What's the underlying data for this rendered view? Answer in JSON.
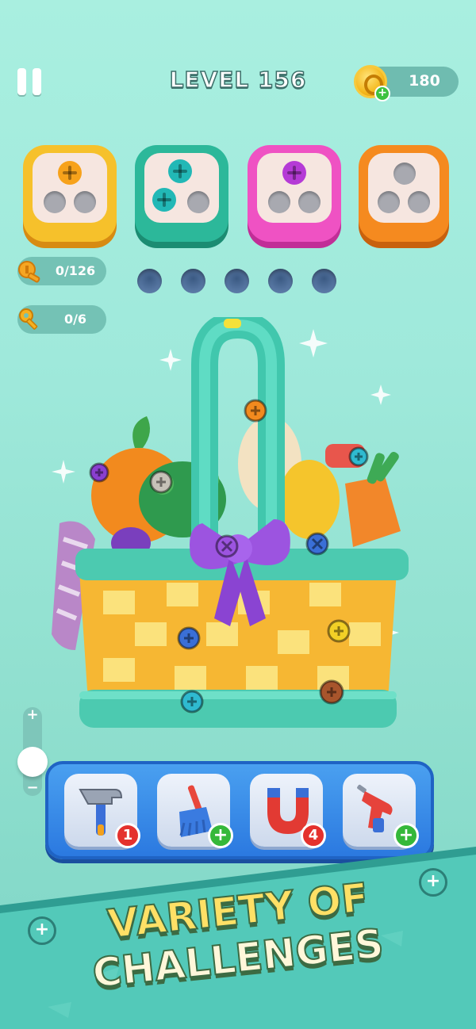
{
  "header": {
    "level_title": "LEVEL 156",
    "coins": "180"
  },
  "screw_boxes": [
    {
      "color": "#f6c12b",
      "screw_color": "#f7a21b",
      "screws_filled": 1
    },
    {
      "color": "#2cb89a",
      "screw_color": "#22b8b6",
      "screws_filled": 2
    },
    {
      "color": "#ef52c3",
      "screw_color": "#b53ad6",
      "screws_filled": 1
    },
    {
      "color": "#f58a1f",
      "screw_color": "",
      "screws_filled": 0
    }
  ],
  "counters": {
    "screws": "0/126",
    "keys": "0/6"
  },
  "slot_holes": 5,
  "boosters": [
    {
      "icon": "hammer-icon",
      "badge": "1",
      "badge_type": "count"
    },
    {
      "icon": "broom-icon",
      "badge": "+",
      "badge_type": "add"
    },
    {
      "icon": "magnet-icon",
      "badge": "4",
      "badge_type": "count"
    },
    {
      "icon": "drill-icon",
      "badge": "+",
      "badge_type": "add"
    }
  ],
  "banner": {
    "line1": "VARIETY OF",
    "line2": "CHALLENGES"
  },
  "colors": {
    "background": "#a9efe0",
    "booster_bar": "#2b79e0",
    "banner": "#53c9b9"
  }
}
